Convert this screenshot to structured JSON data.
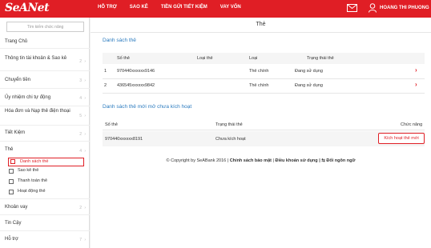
{
  "header": {
    "logo": "SeANet",
    "nav": [
      "HỖ TRỢ",
      "SAO KÊ",
      "TIỀN GỬI TIẾT KIỆM",
      "VAY VỐN"
    ],
    "username": "HOANG THI PHUONG"
  },
  "sidebar": {
    "search_placeholder": "Tìm kiếm chức năng",
    "items": [
      {
        "label": "Trang Chủ",
        "num": ""
      },
      {
        "label": "Thông tin tài khoản & Sao kê",
        "num": "2"
      },
      {
        "label": "Chuyển tiền",
        "num": "3"
      },
      {
        "label": "Ủy nhiệm chi tự động",
        "num": "4"
      },
      {
        "label": "Hóa đơn và Nạp thẻ điện thoại",
        "num": "5"
      },
      {
        "label": "Tiết Kiệm",
        "num": "2"
      },
      {
        "label": "Thẻ",
        "num": "4"
      },
      {
        "label": "Khoản vay",
        "num": "2"
      },
      {
        "label": "Tin Cậy",
        "num": ""
      },
      {
        "label": "Hỗ trợ",
        "num": "7"
      }
    ],
    "card_subitems": [
      "Danh sách thẻ",
      "Sao kê thẻ",
      "Thanh toán thẻ",
      "Hoạt động thẻ"
    ]
  },
  "main": {
    "title": "Thẻ",
    "section1": {
      "title": "Danh sách thẻ",
      "headers": [
        "Số thẻ",
        "Loại thẻ",
        "Loại",
        "Trạng thái thẻ"
      ],
      "rows": [
        {
          "idx": "1",
          "card": "970440xxxxxx9146",
          "type": "",
          "kind": "Thẻ chính",
          "status": "Đang sử dụng"
        },
        {
          "idx": "2",
          "card": "436545xxxxxx9842",
          "type": "",
          "kind": "Thẻ chính",
          "status": "Đang sử dụng"
        }
      ]
    },
    "section2": {
      "title": "Danh sách thẻ mới mở chưa kích hoạt",
      "headers": [
        "Số thẻ",
        "Trạng thái thẻ",
        "Chức năng"
      ],
      "rows": [
        {
          "card": "970440xxxxxx8191",
          "status": "Chưa kích hoạt",
          "action": "Kích hoạt thẻ mới"
        }
      ]
    },
    "footer": {
      "copyright": "© Copyright by SeABank 2016 |",
      "privacy": "Chính sách bảo mật",
      "sep": "|",
      "terms": "Điều khoản sử dụng",
      "lang": "| ⇆ Đổi ngôn ngữ"
    }
  }
}
